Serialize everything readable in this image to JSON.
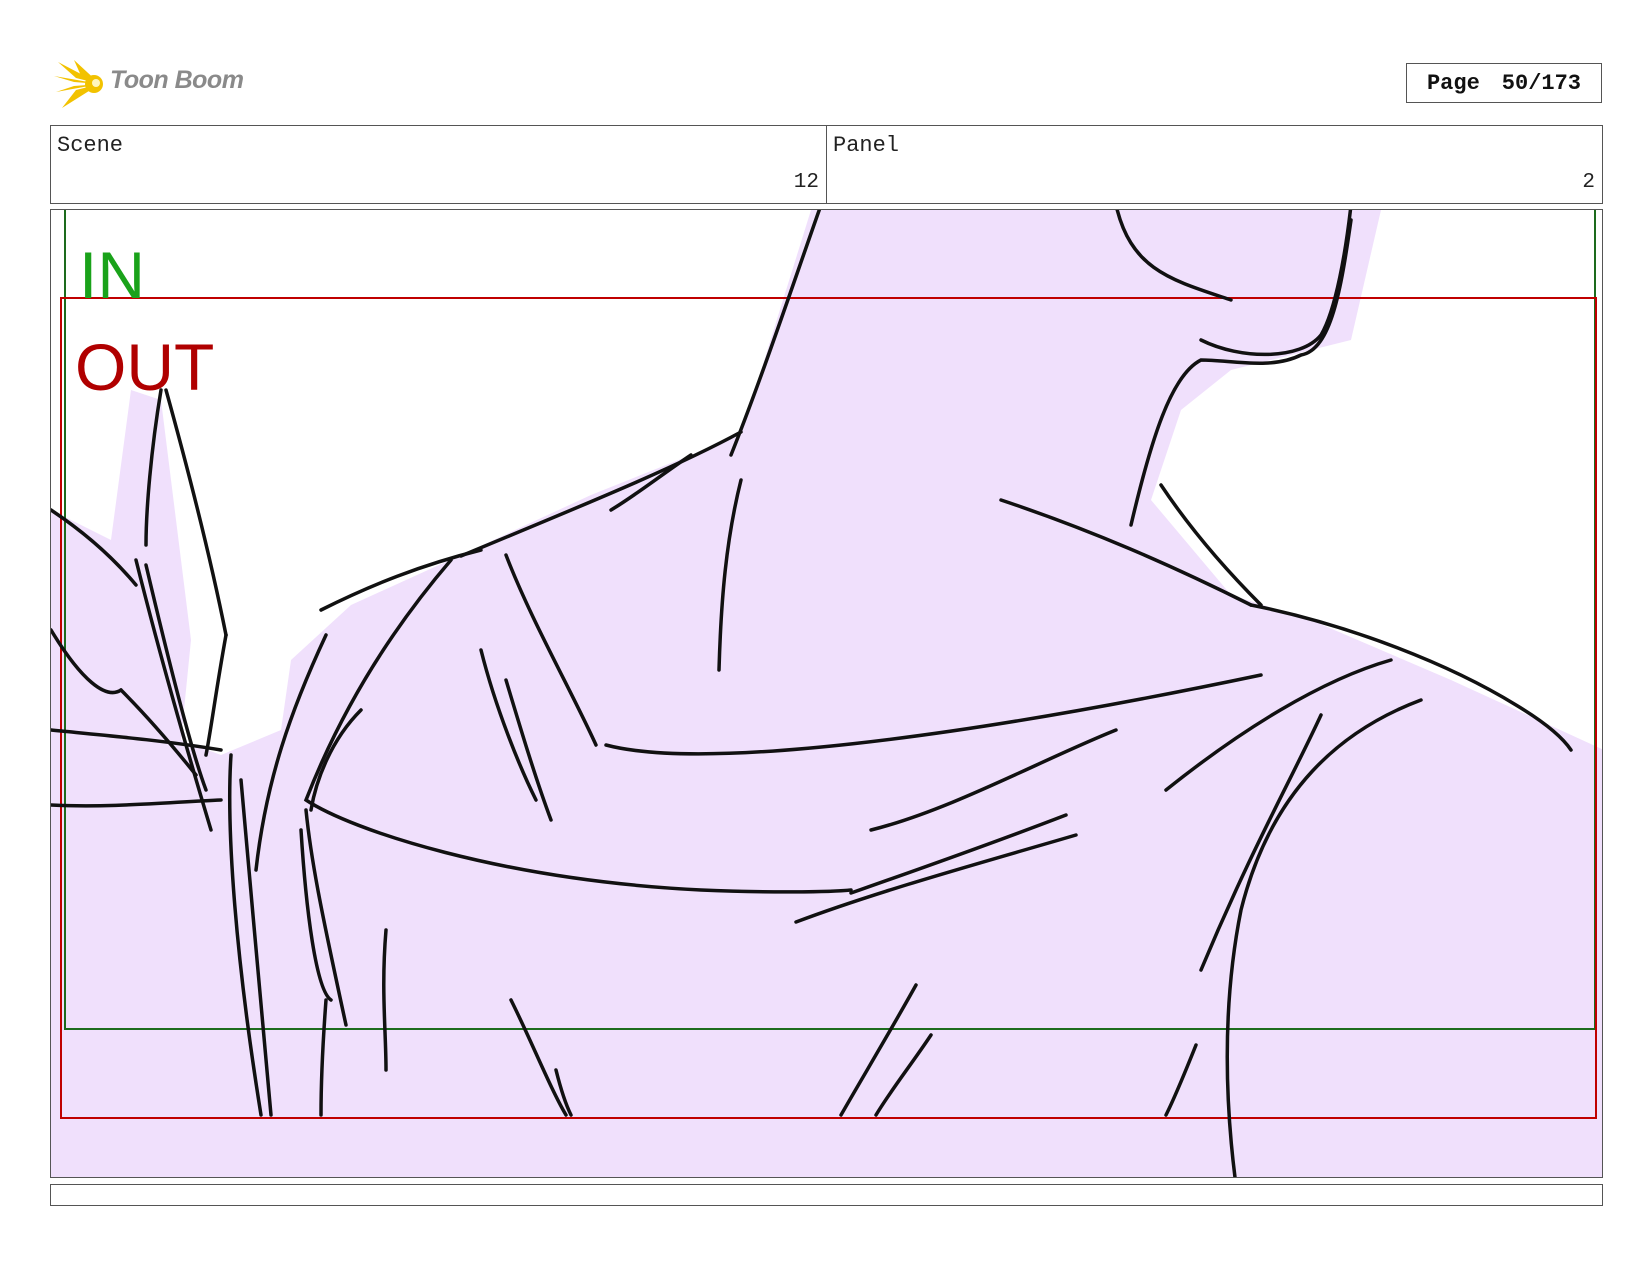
{
  "brand": {
    "name": "Toon Boom",
    "logo_icon": "starburst-icon",
    "logo_color": "#f2c200"
  },
  "page": {
    "label": "Page",
    "current": "50/173"
  },
  "scene": {
    "label": "Scene",
    "value": "12"
  },
  "panel": {
    "label": "Panel",
    "value": "2"
  },
  "frame_marks": {
    "in_label": "IN",
    "in_color": "#1aa21a",
    "out_label": "OUT",
    "out_color": "#b00000",
    "fill_color": "#f0e0fc"
  },
  "notes": {
    "text": ""
  }
}
